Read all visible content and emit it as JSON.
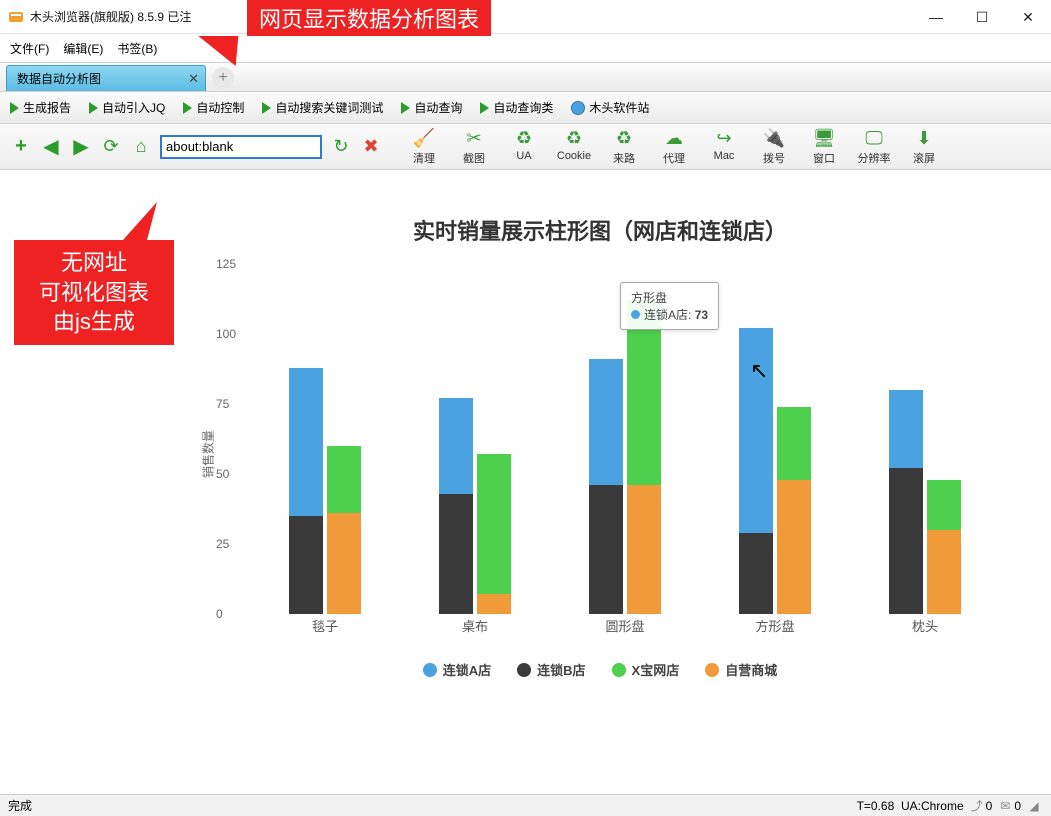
{
  "window": {
    "title": "木头浏览器(旗舰版) 8.5.9  已注"
  },
  "callouts": {
    "top": "网页显示数据分析图表",
    "left": "无网址\n可视化图表\n由js生成"
  },
  "menubar": [
    "文件(F)",
    "编辑(E)",
    "书签(B)"
  ],
  "tabs": {
    "active": "数据自动分析图"
  },
  "actionbar": {
    "items": [
      "生成报告",
      "自动引入JQ",
      "自动控制",
      "自动搜索关键词测试",
      "自动查询",
      "自动查询类"
    ],
    "site": "木头软件站"
  },
  "nav": {
    "url": "about:blank"
  },
  "toolbar": {
    "items": [
      {
        "id": "clean",
        "label": "清理",
        "icon": "🧹"
      },
      {
        "id": "shot",
        "label": "截图",
        "icon": "✂"
      },
      {
        "id": "ua",
        "label": "UA",
        "icon": "♻"
      },
      {
        "id": "cookie",
        "label": "Cookie",
        "icon": "♻"
      },
      {
        "id": "source",
        "label": "来路",
        "icon": "♻"
      },
      {
        "id": "proxy",
        "label": "代理",
        "icon": "☁"
      },
      {
        "id": "mac",
        "label": "Mac",
        "icon": "↪"
      },
      {
        "id": "dial",
        "label": "拨号",
        "icon": "🔌"
      },
      {
        "id": "window",
        "label": "窗口",
        "icon": "🖥"
      },
      {
        "id": "res",
        "label": "分辨率",
        "icon": "🖵"
      },
      {
        "id": "scroll",
        "label": "滚屏",
        "icon": "⬇"
      }
    ]
  },
  "status": {
    "left": "完成",
    "t": "T=0.68",
    "ua": "UA:Chrome",
    "c1": "0",
    "c2": "0"
  },
  "chart_data": {
    "type": "bar",
    "title": "实时销量展示柱形图（网店和连锁店）",
    "ylabel": "销售数量",
    "ylim": [
      0,
      125
    ],
    "yticks": [
      0,
      25,
      50,
      75,
      100,
      125
    ],
    "categories": [
      "毯子",
      "桌布",
      "圆形盘",
      "方形盘",
      "枕头"
    ],
    "series": [
      {
        "name": "连锁A店",
        "color": "#4aa3e0",
        "values": [
          88,
          77,
          91,
          102,
          80
        ]
      },
      {
        "name": "连锁B店",
        "color": "#3a3a3a",
        "values": [
          35,
          43,
          46,
          29,
          52
        ]
      },
      {
        "name": "X宝网店",
        "color": "#4dd04d",
        "values": [
          60,
          57,
          112,
          74,
          48
        ]
      },
      {
        "name": "自营商城",
        "color": "#f09a3a",
        "values": [
          36,
          7,
          46,
          48,
          30
        ]
      }
    ],
    "tooltip": {
      "category": "方形盘",
      "series": "连锁A店",
      "value": 73,
      "color": "#4aa3e0"
    }
  }
}
